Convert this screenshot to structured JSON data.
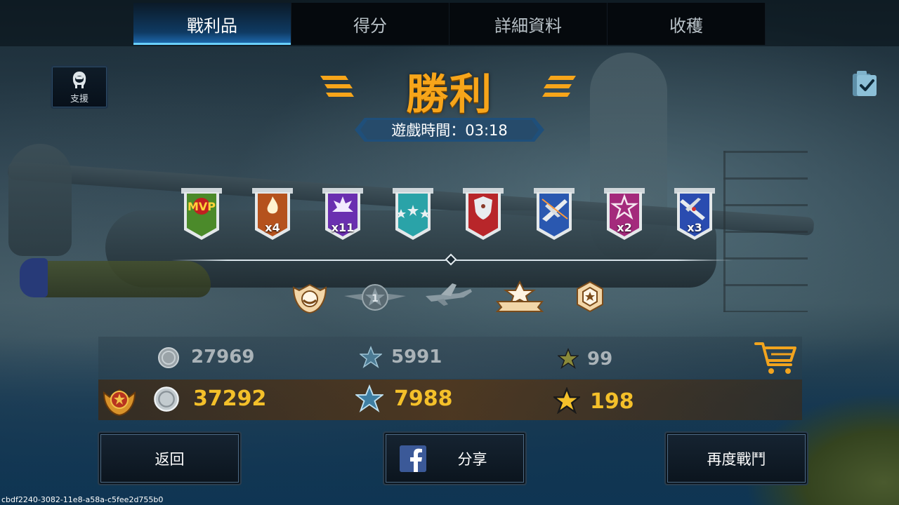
{
  "tabs": [
    {
      "label": "戰利品",
      "active": true
    },
    {
      "label": "得分",
      "active": false
    },
    {
      "label": "詳細資料",
      "active": false
    },
    {
      "label": "收穫",
      "active": false
    }
  ],
  "support": {
    "label": "支援",
    "icon": "pilot-helmet-icon"
  },
  "clipboard": {
    "icon": "clipboard-check-icon"
  },
  "title": "勝利",
  "game_time": "遊戲時間：03:18",
  "medals": [
    {
      "name": "mvp-medal",
      "text": "MVP",
      "count": "",
      "color": "#4b8a2a"
    },
    {
      "name": "fire-medal",
      "count": "x4",
      "color": "#b5521d"
    },
    {
      "name": "explosion-medal",
      "count": "x11",
      "color": "#6a2fb0"
    },
    {
      "name": "three-stars-medal",
      "count": "",
      "color": "#2aa3a8"
    },
    {
      "name": "shield-medal",
      "count": "",
      "color": "#b8262a"
    },
    {
      "name": "plane-blue-medal",
      "count": "",
      "color": "#2a58b0"
    },
    {
      "name": "star-purple-medal",
      "count": "x2",
      "color": "#a42a7c"
    },
    {
      "name": "plane-navy-medal",
      "count": "x3",
      "color": "#2a4cb0"
    }
  ],
  "badges": [
    "rank-crest-badge",
    "wings-badge",
    "plane-badge",
    "star-ribbon-badge",
    "hex-badge"
  ],
  "rewards": {
    "base": {
      "silver": "27969",
      "xp": "5991",
      "gold_star": "99"
    },
    "total": {
      "silver": "37292",
      "xp": "7988",
      "gold_star": "198"
    }
  },
  "buttons": {
    "back": "返回",
    "share": "分享",
    "again": "再度戰鬥"
  },
  "footer_id": "cbdf2240-3082-11e8-a58a-c5fee2d755b0",
  "colors": {
    "accent": "#f7a51a",
    "tab_active": "#1f6fb8",
    "gold_text": "#f4c02a"
  }
}
